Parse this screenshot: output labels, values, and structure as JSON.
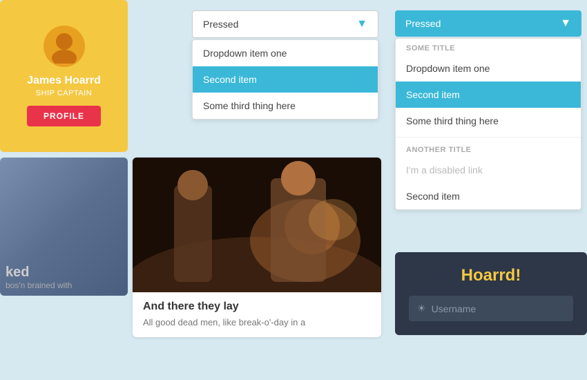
{
  "profile": {
    "name": "James Hoarrd",
    "title": "SHIP CAPTAIN",
    "button_label": "PROFILE"
  },
  "dropdown_simple": {
    "selected_label": "Pressed",
    "items": [
      {
        "label": "Dropdown item one",
        "selected": false
      },
      {
        "label": "Second item",
        "selected": true
      },
      {
        "label": "Some third thing here",
        "selected": false
      }
    ]
  },
  "dropdown_rich": {
    "selected_label": "Pressed",
    "section1_title": "SOME TITLE",
    "section2_title": "ANOTHER TITLE",
    "items_section1": [
      {
        "label": "Dropdown item one",
        "selected": false,
        "disabled": false
      },
      {
        "label": "Second item",
        "selected": true,
        "disabled": false
      },
      {
        "label": "Some third thing here",
        "selected": false,
        "disabled": false
      }
    ],
    "items_section2": [
      {
        "label": "I'm a disabled link",
        "selected": false,
        "disabled": true
      },
      {
        "label": "Second item",
        "selected": false,
        "disabled": false
      }
    ]
  },
  "image_card_left": {
    "partial_text_line1": "ked",
    "partial_text_line2": "bos'n brained with"
  },
  "image_card_center": {
    "title": "And there they lay",
    "description": "All good dead men, like break-o'-day in a"
  },
  "login": {
    "title": "Hoarrd!",
    "username_placeholder": "Username"
  },
  "colors": {
    "accent_blue": "#3bb8d8",
    "accent_yellow": "#f5c842",
    "accent_red": "#e8334a",
    "card_yellow": "#f5c842",
    "dark_card": "#2d3748"
  }
}
